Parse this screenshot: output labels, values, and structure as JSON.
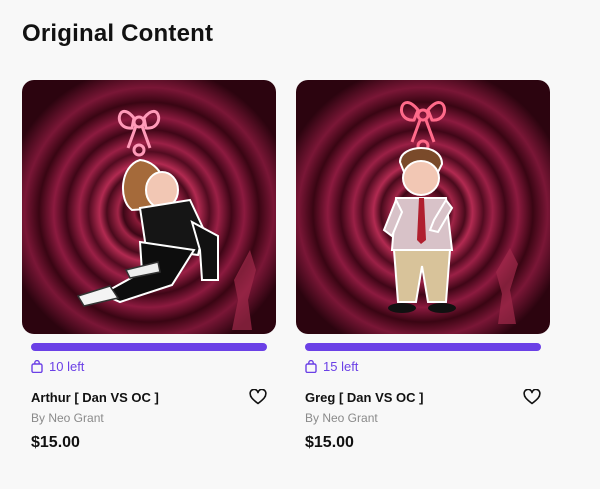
{
  "section": {
    "title": "Original Content"
  },
  "colors": {
    "accent": "#6b40e6",
    "background": "#f8f8f8",
    "thumb_bg": "#8a1a38"
  },
  "products": [
    {
      "stock_label": "10 left",
      "name": "Arthur [ Dan VS OC ]",
      "author": "By Neo Grant",
      "price": "$15.00",
      "icons": [
        "shopping-bag-icon",
        "heart-icon"
      ]
    },
    {
      "stock_label": "15 left",
      "name": "Greg [ Dan VS OC ]",
      "author": "By Neo Grant",
      "price": "$15.00",
      "icons": [
        "shopping-bag-icon",
        "heart-icon"
      ]
    }
  ]
}
